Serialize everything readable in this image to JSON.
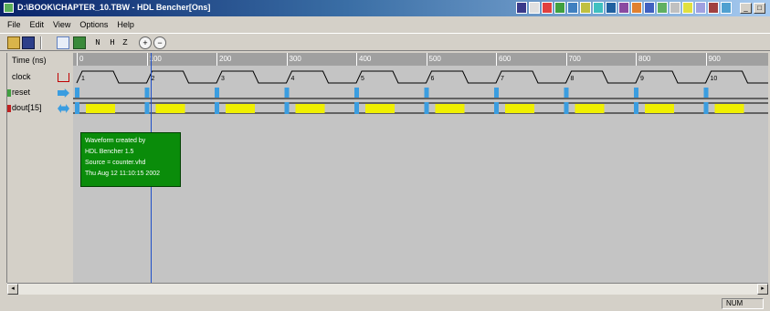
{
  "window": {
    "title": "D:\\BOOK\\CHAPTER_10.TBW - HDL Bencher[Ons]",
    "buttons": [
      "_",
      "□",
      "×"
    ]
  },
  "menu": [
    "File",
    "Edit",
    "View",
    "Options",
    "Help"
  ],
  "toolbar": {
    "b5": "N",
    "b6": "H",
    "b7": "Z"
  },
  "signals": [
    {
      "name": "Time (ns)",
      "icon": ""
    },
    {
      "name": "clock",
      "icon": "clock-icon"
    },
    {
      "name": "reset",
      "icon": "input-arrow-icon"
    },
    {
      "name": "dout[15]",
      "icon": "bidirectional-arrow-icon"
    }
  ],
  "timeline": {
    "ticks": [
      "0",
      "100",
      "200",
      "300",
      "400",
      "500",
      "600",
      "700",
      "800",
      "900"
    ],
    "cycle_labels": [
      "1",
      "2",
      "3",
      "4",
      "5",
      "6",
      "7",
      "8",
      "9",
      "10"
    ]
  },
  "annotation": [
    "Waveform created by",
    "HDL Bencher 1.5",
    "Source = counter.vhd",
    "Thu Aug 12 11:10:15 2002"
  ],
  "status": "NUM",
  "colors": {
    "title_start": "#0a246a",
    "wave_bg": "#c4c4c4",
    "ruler": "#a0a0a0",
    "clock_red": "#c00000",
    "cyan_marker": "#3a9de0",
    "yellow_bus": "#f0f000",
    "annotation_green": "#0a8c0a",
    "cursor_blue": "#2050c8"
  }
}
